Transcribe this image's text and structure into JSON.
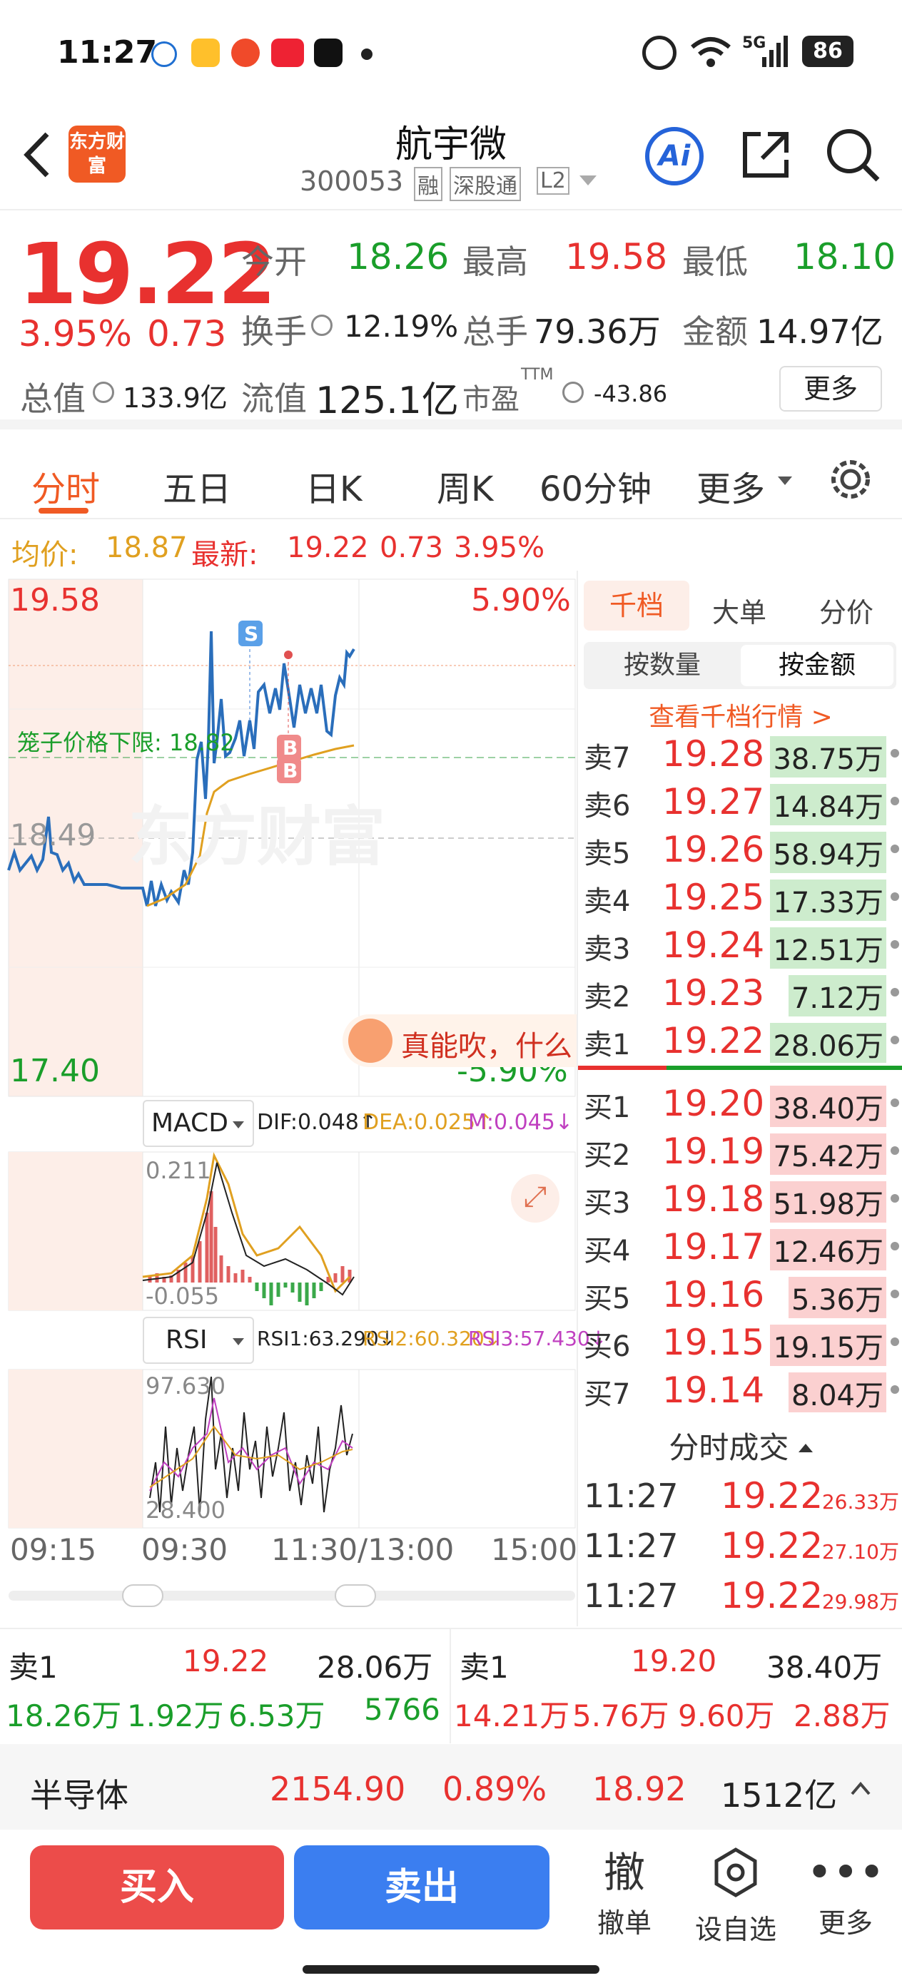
{
  "status": {
    "time": "11:27",
    "network": "5G",
    "battery": "86"
  },
  "nav": {
    "title": "航宇微",
    "code": "300053",
    "tag_rong": "融",
    "tag_market": "深股通",
    "tag_level": "L2",
    "logo_text": "东方财富",
    "ai": "Ai"
  },
  "quote": {
    "price": "19.22",
    "pct": "3.95%",
    "chg": "0.73",
    "open_label": "今开",
    "open": "18.26",
    "high_label": "最高",
    "high": "19.58",
    "low_label": "最低",
    "low": "18.10",
    "turn_label": "换手",
    "turn": "12.19%",
    "vol_label": "总手",
    "vol": "79.36万",
    "amt_label": "金额",
    "amt": "14.97亿",
    "mcap_label": "总值",
    "mcap": "133.9亿",
    "fcap_label": "流值",
    "fcap": "125.1亿",
    "pe_label": "市盈",
    "pe_sup": "TTM",
    "pe": "-43.86",
    "more": "更多"
  },
  "tabs": [
    "分时",
    "五日",
    "日K",
    "周K",
    "60分钟",
    "更多"
  ],
  "avg": {
    "avg_label": "均价:",
    "avg": "18.87",
    "last_label": "最新:",
    "last": "19.22",
    "chg": "0.73",
    "pct": "3.95%"
  },
  "chart": {
    "y_high": "19.58",
    "y_mid": "18.49",
    "y_low": "17.40",
    "pct_high": "5.90%",
    "pct_low": "-5.90%",
    "cage_label": "笼子价格下限: 18.82",
    "watermark": "东方财富",
    "bubble": "真能吹，什么",
    "tag_s": "S",
    "tag_b": "B",
    "macd_label": "MACD",
    "dif": "DIF:0.048↑",
    "dea": "DEA:0.025↑",
    "m": "M:0.045↓",
    "macd_hi": "0.211",
    "macd_lo": "-0.055",
    "rsi_label": "RSI",
    "rsi1": "RSI1:63.290↓",
    "rsi2": "RSI2:60.320↓",
    "rsi3": "RSI3:57.430↓",
    "rsi_hi": "97.630",
    "rsi_lo": "28.400",
    "times": [
      "09:15",
      "09:30",
      "11:30/13:00",
      "15:00"
    ],
    "colors": {
      "price": "#2a6ebb",
      "avg": "#e0a020",
      "up": "#e8312f",
      "down": "#1a9e2a"
    }
  },
  "side": {
    "tabs": [
      "千档",
      "大单",
      "分价"
    ],
    "sub": [
      "按数量",
      "按金额"
    ],
    "link": "查看千档行情 >",
    "asks": [
      {
        "label": "卖7",
        "price": "19.28",
        "vol": "38.75万"
      },
      {
        "label": "卖6",
        "price": "19.27",
        "vol": "14.84万"
      },
      {
        "label": "卖5",
        "price": "19.26",
        "vol": "58.94万"
      },
      {
        "label": "卖4",
        "price": "19.25",
        "vol": "17.33万"
      },
      {
        "label": "卖3",
        "price": "19.24",
        "vol": "12.51万"
      },
      {
        "label": "卖2",
        "price": "19.23",
        "vol": "7.12万"
      },
      {
        "label": "卖1",
        "price": "19.22",
        "vol": "28.06万"
      }
    ],
    "bids": [
      {
        "label": "买1",
        "price": "19.20",
        "vol": "38.40万"
      },
      {
        "label": "买2",
        "price": "19.19",
        "vol": "75.42万"
      },
      {
        "label": "买3",
        "price": "19.18",
        "vol": "51.98万"
      },
      {
        "label": "买4",
        "price": "19.17",
        "vol": "12.46万"
      },
      {
        "label": "买5",
        "price": "19.16",
        "vol": "5.36万"
      },
      {
        "label": "买6",
        "price": "19.15",
        "vol": "19.15万"
      },
      {
        "label": "买7",
        "price": "19.14",
        "vol": "8.04万"
      }
    ],
    "trades_title": "分时成交",
    "trades": [
      {
        "time": "11:27",
        "price": "19.22",
        "vol": "26.33万"
      },
      {
        "time": "11:27",
        "price": "19.22",
        "vol": "27.10万"
      },
      {
        "time": "11:27",
        "price": "19.22",
        "vol": "29.98万"
      }
    ]
  },
  "bottom": {
    "left": {
      "label": "卖1",
      "price": "19.22",
      "vol": "28.06万",
      "v1": "18.26万",
      "v2": "1.92万",
      "v3": "6.53万",
      "v4": "5766"
    },
    "right": {
      "label": "卖1",
      "price": "19.20",
      "vol": "38.40万",
      "v1": "14.21万",
      "v2": "5.76万",
      "v3": "9.60万",
      "v4": "2.88万"
    }
  },
  "sector": {
    "name": "半导体",
    "value": "2154.90",
    "pct": "0.89%",
    "x": "18.92",
    "amt": "1512亿"
  },
  "actions": {
    "buy": "买入",
    "sell": "卖出",
    "cancel_icon": "撤",
    "cancel": "撤单",
    "watch": "设自选",
    "more": "更多"
  }
}
